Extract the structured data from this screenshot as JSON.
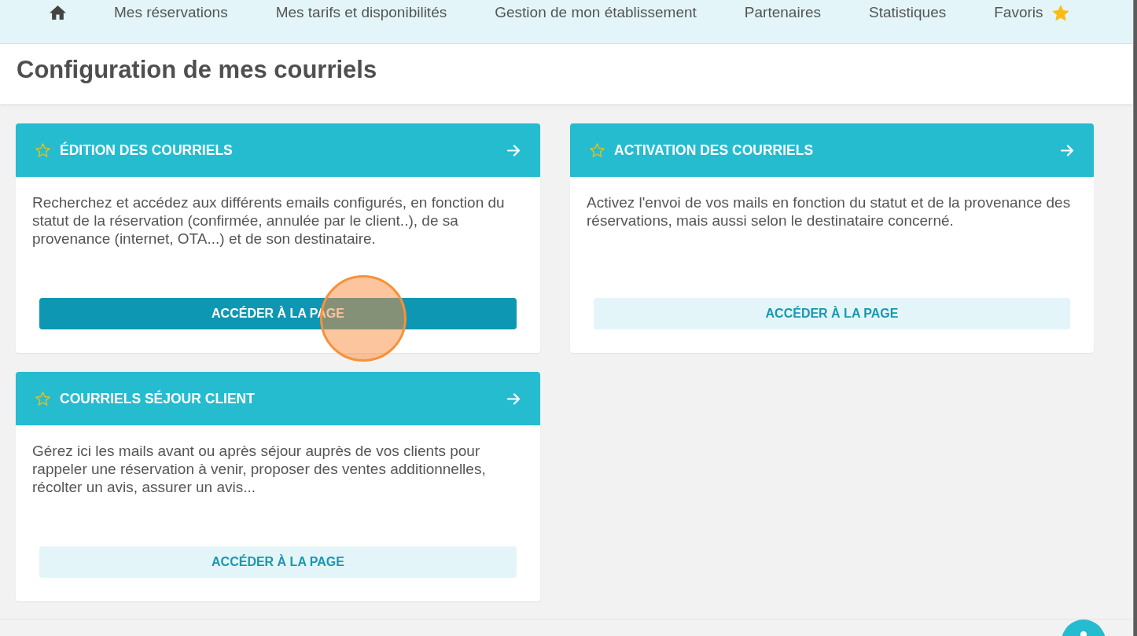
{
  "nav": {
    "items": [
      {
        "kind": "home"
      },
      {
        "kind": "link",
        "label": "Mes réservations"
      },
      {
        "kind": "link",
        "label": "Mes tarifs et disponibilités"
      },
      {
        "kind": "link",
        "label": "Gestion de mon établissement"
      },
      {
        "kind": "link",
        "label": "Partenaires"
      },
      {
        "kind": "link",
        "label": "Statistiques"
      },
      {
        "kind": "favorites",
        "label": "Favoris"
      }
    ]
  },
  "page": {
    "title": "Configuration de mes courriels"
  },
  "cards": [
    {
      "title": "ÉDITION DES COURRIELS",
      "favorite": false,
      "description": "Recherchez et accédez aux différents emails configurés, en fonction du statut de la réservation (confirmée, annulée par le client..), de sa provenance (internet, OTA...) et de son destinataire.",
      "button": {
        "label": "ACCÉDER À LA PAGE",
        "highlighted": true,
        "clicked": true
      }
    },
    {
      "title": "ACTIVATION DES COURRIELS",
      "favorite": false,
      "description": "Activez l'envoi de vos mails en fonction du statut et de la provenance des réservations, mais aussi selon le destinataire concerné.",
      "button": {
        "label": "ACCÉDER À LA PAGE",
        "highlighted": false,
        "clicked": false
      }
    },
    {
      "title": "COURRIELS SÉJOUR CLIENT",
      "favorite": false,
      "description": "Gérez ici les mails avant ou après séjour auprès de vos clients pour rappeler une réservation à venir, proposer des ventes additionnelles, récolter un avis, assurer un avis...",
      "button": {
        "label": "ACCÉDER À LA PAGE",
        "highlighted": false,
        "clicked": false
      }
    }
  ]
}
